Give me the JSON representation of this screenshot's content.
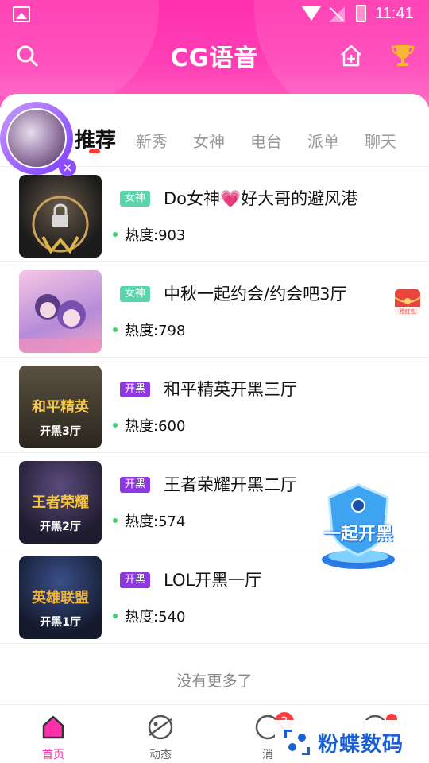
{
  "status_bar": {
    "time": "11:41"
  },
  "header": {
    "title": "CG语音"
  },
  "tabs": [
    "推荐",
    "新秀",
    "女神",
    "电台",
    "派单",
    "聊天"
  ],
  "rooms": [
    {
      "tag": "女神",
      "name": "Do女神💗好大哥的避风港",
      "heat": "热度:903"
    },
    {
      "tag": "女神",
      "name": "中秋一起约会/约会吧3厅",
      "heat": "热度:798",
      "extra_label": "抢红包"
    },
    {
      "tag": "开黑",
      "name": "和平精英开黑三厅",
      "heat": "热度:600",
      "thumb_title": "和平精英",
      "thumb_caption": "开黑3厅"
    },
    {
      "tag": "开黑",
      "name": "王者荣耀开黑二厅",
      "heat": "热度:574",
      "thumb_title": "王者荣耀",
      "thumb_caption": "开黑2厅"
    },
    {
      "tag": "开黑",
      "name": "LOL开黑一厅",
      "heat": "热度:540",
      "thumb_title": "英雄联盟",
      "thumb_caption": "开黑1厅"
    }
  ],
  "floating_badge": {
    "label": "一起开黑"
  },
  "footer_text": "没有更多了",
  "bottom_nav": [
    {
      "label": "首页"
    },
    {
      "label": "动态"
    },
    {
      "label": "消"
    },
    {
      "label": ""
    }
  ],
  "message_badge": "2",
  "watermark": "粉蝶数码",
  "colors": {
    "brand_pink": "#ff2fae",
    "goddess_tag": "#5ad5a9",
    "kaihei_tag": "#8d38e0"
  }
}
